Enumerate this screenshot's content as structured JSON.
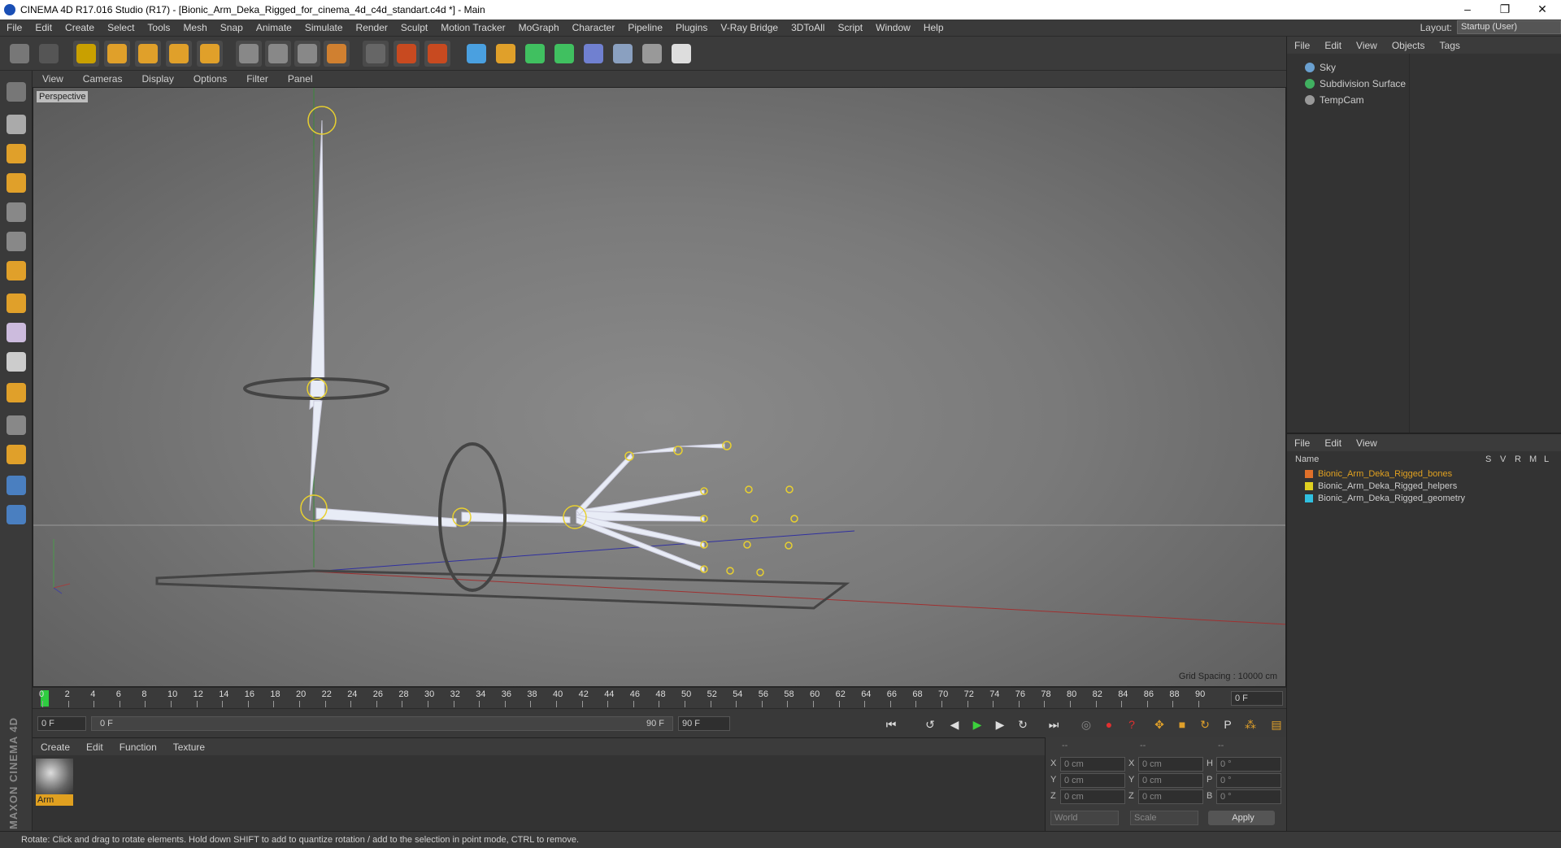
{
  "window": {
    "title": "CINEMA 4D R17.016 Studio (R17) - [Bionic_Arm_Deka_Rigged_for_cinema_4d_c4d_standart.c4d *] - Main",
    "controls": [
      "–",
      "❐",
      "✕"
    ]
  },
  "menu": {
    "items": [
      "File",
      "Edit",
      "Create",
      "Select",
      "Tools",
      "Mesh",
      "Snap",
      "Animate",
      "Simulate",
      "Render",
      "Sculpt",
      "Motion Tracker",
      "MoGraph",
      "Character",
      "Pipeline",
      "Plugins",
      "V-Ray Bridge",
      "3DToAll",
      "Script",
      "Window",
      "Help"
    ],
    "layout_label": "Layout:",
    "layout_value": "Startup (User)"
  },
  "toolbar": {
    "buttons": [
      {
        "name": "undo",
        "color": "#777"
      },
      {
        "name": "redo",
        "color": "#555"
      },
      {
        "name": "select",
        "color": "#c9a000"
      },
      {
        "name": "move",
        "color": "#e0a02a"
      },
      {
        "name": "scale",
        "color": "#e0a02a"
      },
      {
        "name": "rotate",
        "color": "#e0a02a"
      },
      {
        "name": "recent-tool",
        "color": "#e0a02a"
      },
      {
        "name": "x-axis",
        "color": "#888"
      },
      {
        "name": "y-axis",
        "color": "#888"
      },
      {
        "name": "z-axis",
        "color": "#888"
      },
      {
        "name": "coordinate-system",
        "color": "#d08030"
      },
      {
        "name": "render-view",
        "color": "#666"
      },
      {
        "name": "render-picture-viewer",
        "color": "#c84a20"
      },
      {
        "name": "edit-render-settings",
        "color": "#c84a20"
      },
      {
        "name": "cube",
        "color": "#4aa0e0"
      },
      {
        "name": "pen",
        "color": "#e0a02a"
      },
      {
        "name": "subdivision",
        "color": "#40c060"
      },
      {
        "name": "array",
        "color": "#40c060"
      },
      {
        "name": "deformer",
        "color": "#7080d0"
      },
      {
        "name": "floor",
        "color": "#8aa0c0"
      },
      {
        "name": "camera",
        "color": "#999"
      },
      {
        "name": "light",
        "color": "#ddd"
      }
    ]
  },
  "left_tools": [
    "make-editable",
    "model-mode",
    "texture-mode",
    "workplane",
    "points-mode",
    "edges-mode",
    "polygons-mode",
    "axis",
    "tweak",
    "solo",
    "snap",
    "sculpt-lock",
    "paint",
    "python",
    "python-2"
  ],
  "viewport": {
    "menus": [
      "View",
      "Cameras",
      "Display",
      "Options",
      "Filter",
      "Panel"
    ],
    "label": "Perspective",
    "grid_spacing": "Grid Spacing : 10000 cm"
  },
  "timeline": {
    "ticks": [
      "0",
      "2",
      "4",
      "6",
      "8",
      "10",
      "12",
      "14",
      "16",
      "18",
      "20",
      "22",
      "24",
      "26",
      "28",
      "30",
      "32",
      "34",
      "36",
      "38",
      "40",
      "42",
      "44",
      "46",
      "48",
      "50",
      "52",
      "54",
      "56",
      "58",
      "60",
      "62",
      "64",
      "66",
      "68",
      "70",
      "72",
      "74",
      "76",
      "78",
      "80",
      "82",
      "84",
      "86",
      "88",
      "90"
    ],
    "current_frame": "0 F"
  },
  "playback": {
    "start": "0 F",
    "range_start": "0 F",
    "range_end": "90 F",
    "end": "90 F"
  },
  "materials": {
    "menus": [
      "Create",
      "Edit",
      "Function",
      "Texture"
    ],
    "items": [
      {
        "name": "Arm"
      }
    ]
  },
  "attributes": {
    "headers": [
      "--",
      "--",
      "--"
    ],
    "rows": [
      {
        "a": "X",
        "av": "0 cm",
        "b": "X",
        "bv": "0 cm",
        "c": "H",
        "cv": "0 °"
      },
      {
        "a": "Y",
        "av": "0 cm",
        "b": "Y",
        "bv": "0 cm",
        "c": "P",
        "cv": "0 °"
      },
      {
        "a": "Z",
        "av": "0 cm",
        "b": "Z",
        "bv": "0 cm",
        "c": "B",
        "cv": "0 °"
      }
    ],
    "world": "World",
    "scale": "Scale",
    "apply": "Apply"
  },
  "objects": {
    "menus": [
      "File",
      "Edit",
      "View",
      "Objects",
      "Tags"
    ],
    "items": [
      {
        "name": "Sky",
        "icon_color": "#6aa0d0"
      },
      {
        "name": "Subdivision Surface",
        "icon_color": "#40b060"
      },
      {
        "name": "TempCam",
        "icon_color": "#999999"
      }
    ]
  },
  "layers": {
    "menus": [
      "File",
      "Edit",
      "View"
    ],
    "columns": [
      "Name",
      "S",
      "V",
      "R",
      "M",
      "L"
    ],
    "items": [
      {
        "name": "Bionic_Arm_Deka_Rigged_bones",
        "color": "#e0702a",
        "text_color": "#e0a020"
      },
      {
        "name": "Bionic_Arm_Deka_Rigged_helpers",
        "color": "#e0d020",
        "text_color": "#cccccc"
      },
      {
        "name": "Bionic_Arm_Deka_Rigged_geometry",
        "color": "#30c0e0",
        "text_color": "#cccccc"
      }
    ]
  },
  "status": {
    "text": "Rotate: Click and drag to rotate elements. Hold down SHIFT to add to quantize rotation / add to the selection in point mode, CTRL to remove."
  }
}
